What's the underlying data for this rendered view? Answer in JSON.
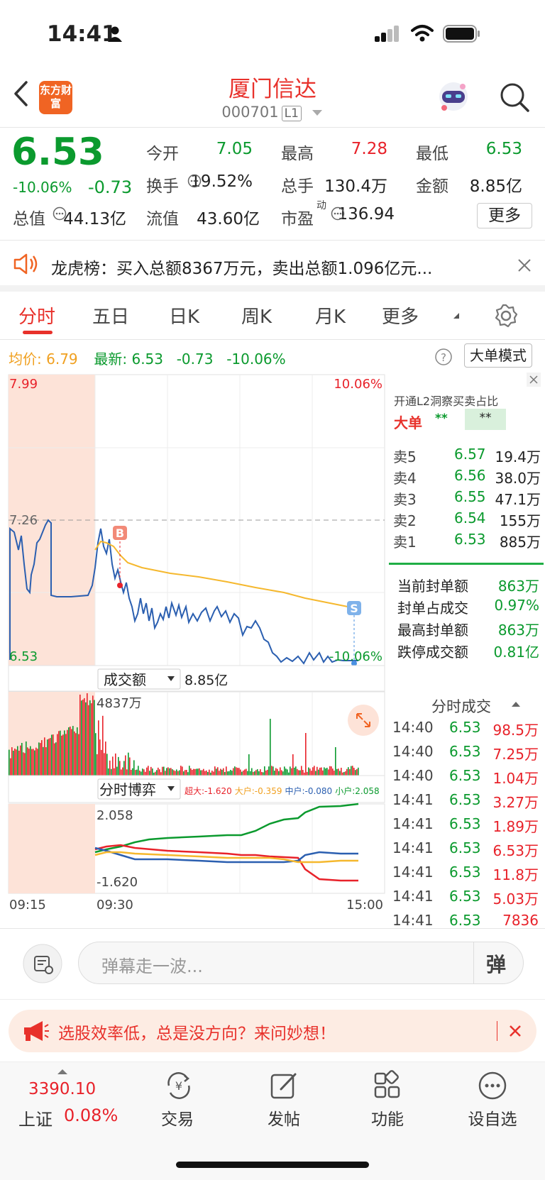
{
  "status_bar": {
    "time": "14:41"
  },
  "header": {
    "title": "厦门信达",
    "code": "000701",
    "level": "L1",
    "logo_text": "东方财富"
  },
  "quote": {
    "price": "6.53",
    "change_pct": "-10.06%",
    "change": "-0.73",
    "fields": [
      {
        "label": "今开",
        "value": "7.05",
        "color": "green"
      },
      {
        "label": "最高",
        "value": "7.28",
        "color": "red"
      },
      {
        "label": "最低",
        "value": "6.53",
        "color": "green"
      },
      {
        "label": "换手",
        "value": "19.52%",
        "color": "dark"
      },
      {
        "label": "总手",
        "value": "130.4万",
        "color": "dark"
      },
      {
        "label": "金额",
        "value": "8.85亿",
        "color": "dark"
      },
      {
        "label": "总值",
        "value": "44.13亿",
        "color": "dark"
      },
      {
        "label": "流值",
        "value": "43.60亿",
        "color": "dark"
      },
      {
        "label": "市盈",
        "value": "136.94",
        "color": "dark",
        "sup": "动"
      }
    ],
    "more_label": "更多"
  },
  "notice": {
    "text": "龙虎榜：买入总额8367万元，卖出总额1.096亿元..."
  },
  "tabs": [
    "分时",
    "五日",
    "日K",
    "周K",
    "月K",
    "更多"
  ],
  "info": {
    "avg_label": "均价:",
    "avg": "6.79",
    "latest_label": "最新:",
    "latest": "6.53",
    "chg": "-0.73",
    "pct": "-10.06%",
    "mode_btn": "大单模式"
  },
  "chart_labels": {
    "top_price": "7.99",
    "top_pct": "10.06%",
    "ref_price": "7.26",
    "bottom_price": "6.53",
    "bottom_pct": "-10.06%",
    "buy_marker": "B",
    "sell_marker": "S",
    "vol_selector": "成交额",
    "vol_total": "8.85亿",
    "vol_max": "4837万",
    "flow_selector": "分时博弈",
    "flow_legend": [
      {
        "label": "超大:-1.620",
        "color": "#e8222a"
      },
      {
        "label": "大户:-0.359",
        "color": "#f0a020"
      },
      {
        "label": "中户:-0.080",
        "color": "#2b5fb0"
      },
      {
        "label": "小户:2.058",
        "color": "#0b9a2e"
      }
    ],
    "flow_max": "2.058",
    "flow_min": "-1.620",
    "time_start": "09:15",
    "time_open": "09:30",
    "time_end": "15:00"
  },
  "order_book": {
    "l2_link": "开通L2洞察买卖占比",
    "big_label": "大单",
    "big_v1": "**",
    "big_v2": "**",
    "asks": [
      {
        "label": "卖5",
        "price": "6.57",
        "vol": "19.4万"
      },
      {
        "label": "卖4",
        "price": "6.56",
        "vol": "38.0万"
      },
      {
        "label": "卖3",
        "price": "6.55",
        "vol": "47.1万"
      },
      {
        "label": "卖2",
        "price": "6.54",
        "vol": "155万"
      },
      {
        "label": "卖1",
        "price": "6.53",
        "vol": "885万"
      }
    ],
    "stats": [
      {
        "label": "当前封单额",
        "value": "863万"
      },
      {
        "label": "封单占成交",
        "value": "0.97%"
      },
      {
        "label": "最高封单额",
        "value": "863万"
      },
      {
        "label": "跌停成交额",
        "value": "0.81亿"
      }
    ],
    "ticks_title": "分时成交",
    "ticks": [
      {
        "time": "14:40",
        "price": "6.53",
        "vol": "98.5万",
        "color": "red"
      },
      {
        "time": "14:40",
        "price": "6.53",
        "vol": "7.25万",
        "color": "red"
      },
      {
        "time": "14:40",
        "price": "6.53",
        "vol": "1.04万",
        "color": "red"
      },
      {
        "time": "14:41",
        "price": "6.53",
        "vol": "3.27万",
        "color": "red"
      },
      {
        "time": "14:41",
        "price": "6.53",
        "vol": "1.89万",
        "color": "red"
      },
      {
        "time": "14:41",
        "price": "6.53",
        "vol": "6.53万",
        "color": "red"
      },
      {
        "time": "14:41",
        "price": "6.53",
        "vol": "11.8万",
        "color": "red"
      },
      {
        "time": "14:41",
        "price": "6.53",
        "vol": "5.03万",
        "color": "red"
      },
      {
        "time": "14:41",
        "price": "6.53",
        "vol": "7836",
        "color": "red"
      }
    ]
  },
  "danmu": {
    "placeholder": "弹幕走一波...",
    "send_label": "弹"
  },
  "ad": {
    "text": "选股效率低，总是没方向？来问妙想！"
  },
  "bottom_nav": {
    "index_value": "3390.10",
    "index_name": "上证",
    "index_pct": "0.08%",
    "items": [
      {
        "label": "交易",
        "icon": "yuan-exchange-icon"
      },
      {
        "label": "发帖",
        "icon": "edit-icon"
      },
      {
        "label": "功能",
        "icon": "grid-icon"
      },
      {
        "label": "设自选",
        "icon": "more-dots-icon"
      }
    ]
  }
}
